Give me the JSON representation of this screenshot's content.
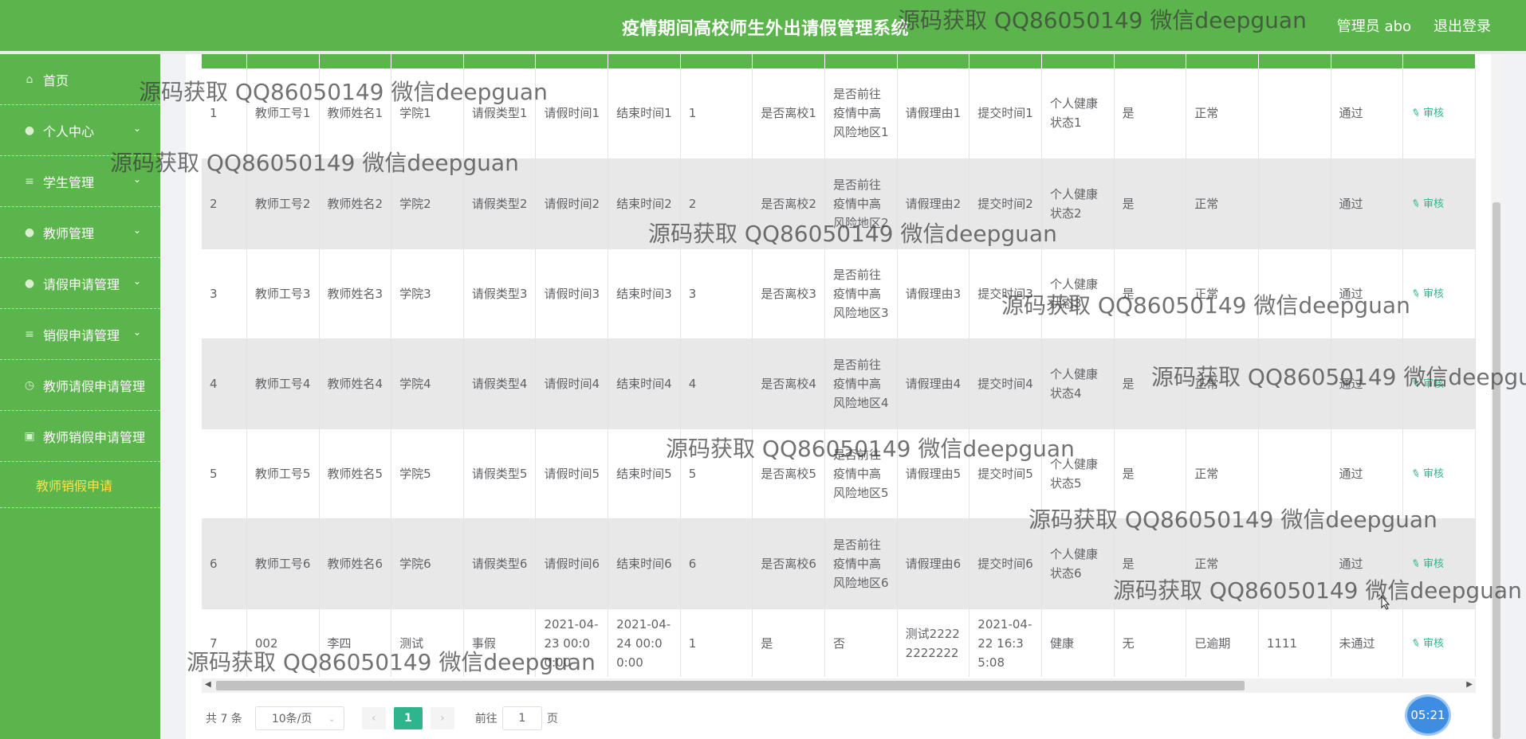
{
  "header": {
    "title": "疫情期间高校师生外出请假管理系统",
    "user": "管理员 abo",
    "logout": "退出登录"
  },
  "sidebar": {
    "items": [
      {
        "label": "首页",
        "icon": "home-icon",
        "glyph": "⌂",
        "expandable": false
      },
      {
        "label": "个人中心",
        "icon": "user-icon",
        "glyph": "●",
        "expandable": true
      },
      {
        "label": "学生管理",
        "icon": "list-icon",
        "glyph": "≡",
        "expandable": true
      },
      {
        "label": "教师管理",
        "icon": "teacher-icon",
        "glyph": "●",
        "expandable": true
      },
      {
        "label": "请假申请管理",
        "icon": "user-icon",
        "glyph": "●",
        "expandable": true
      },
      {
        "label": "销假申请管理",
        "icon": "list-icon",
        "glyph": "≡",
        "expandable": true
      },
      {
        "label": "教师请假申请管理",
        "icon": "clock-icon",
        "glyph": "◷",
        "expandable": false
      },
      {
        "label": "教师销假申请管理",
        "icon": "briefcase-icon",
        "glyph": "▣",
        "expandable": false
      }
    ],
    "sub_item": "教师销假申请"
  },
  "table": {
    "audit_label": "审核",
    "rows": [
      {
        "no": "1",
        "tid": "教师工号1",
        "tname": "教师姓名1",
        "college": "学院1",
        "type": "请假类型1",
        "start": "请假时间1",
        "end": "结束时间1",
        "days": "1",
        "leave_school": "是否离校1",
        "risk_area": "是否前往疫情中高风险地区1",
        "reason": "请假理由1",
        "submit": "提交时间1",
        "health": "个人健康状态1",
        "c1": "是",
        "c2": "正常",
        "c3": "",
        "status": "通过"
      },
      {
        "no": "2",
        "tid": "教师工号2",
        "tname": "教师姓名2",
        "college": "学院2",
        "type": "请假类型2",
        "start": "请假时间2",
        "end": "结束时间2",
        "days": "2",
        "leave_school": "是否离校2",
        "risk_area": "是否前往疫情中高风险地区2",
        "reason": "请假理由2",
        "submit": "提交时间2",
        "health": "个人健康状态2",
        "c1": "是",
        "c2": "正常",
        "c3": "",
        "status": "通过"
      },
      {
        "no": "3",
        "tid": "教师工号3",
        "tname": "教师姓名3",
        "college": "学院3",
        "type": "请假类型3",
        "start": "请假时间3",
        "end": "结束时间3",
        "days": "3",
        "leave_school": "是否离校3",
        "risk_area": "是否前往疫情中高风险地区3",
        "reason": "请假理由3",
        "submit": "提交时间3",
        "health": "个人健康状态3",
        "c1": "是",
        "c2": "正常",
        "c3": "",
        "status": "通过"
      },
      {
        "no": "4",
        "tid": "教师工号4",
        "tname": "教师姓名4",
        "college": "学院4",
        "type": "请假类型4",
        "start": "请假时间4",
        "end": "结束时间4",
        "days": "4",
        "leave_school": "是否离校4",
        "risk_area": "是否前往疫情中高风险地区4",
        "reason": "请假理由4",
        "submit": "提交时间4",
        "health": "个人健康状态4",
        "c1": "是",
        "c2": "正常",
        "c3": "",
        "status": "通过"
      },
      {
        "no": "5",
        "tid": "教师工号5",
        "tname": "教师姓名5",
        "college": "学院5",
        "type": "请假类型5",
        "start": "请假时间5",
        "end": "结束时间5",
        "days": "5",
        "leave_school": "是否离校5",
        "risk_area": "是否前往疫情中高风险地区5",
        "reason": "请假理由5",
        "submit": "提交时间5",
        "health": "个人健康状态5",
        "c1": "是",
        "c2": "正常",
        "c3": "",
        "status": "通过"
      },
      {
        "no": "6",
        "tid": "教师工号6",
        "tname": "教师姓名6",
        "college": "学院6",
        "type": "请假类型6",
        "start": "请假时间6",
        "end": "结束时间6",
        "days": "6",
        "leave_school": "是否离校6",
        "risk_area": "是否前往疫情中高风险地区6",
        "reason": "请假理由6",
        "submit": "提交时间6",
        "health": "个人健康状态6",
        "c1": "是",
        "c2": "正常",
        "c3": "",
        "status": "通过"
      },
      {
        "no": "7",
        "tid": "002",
        "tname": "李四",
        "college": "测试",
        "type": "事假",
        "start": "2021-04-23 00:00:00",
        "end": "2021-04-24 00:00:00",
        "days": "1",
        "leave_school": "是",
        "risk_area": "否",
        "reason": "测试22222222222",
        "submit": "2021-04-22 16:35:08",
        "health": "健康",
        "c1": "无",
        "c2": "已逾期",
        "c3": "1111",
        "status": "未通过"
      }
    ]
  },
  "pagination": {
    "total": "共 7 条",
    "page_size": "10条/页",
    "prev": "‹",
    "current": "1",
    "next": "›",
    "goto_label": "前往",
    "goto_value": "1",
    "page_suffix": "页"
  },
  "clock": "05:21",
  "watermark": "源码获取 QQ86050149 微信deepguan"
}
